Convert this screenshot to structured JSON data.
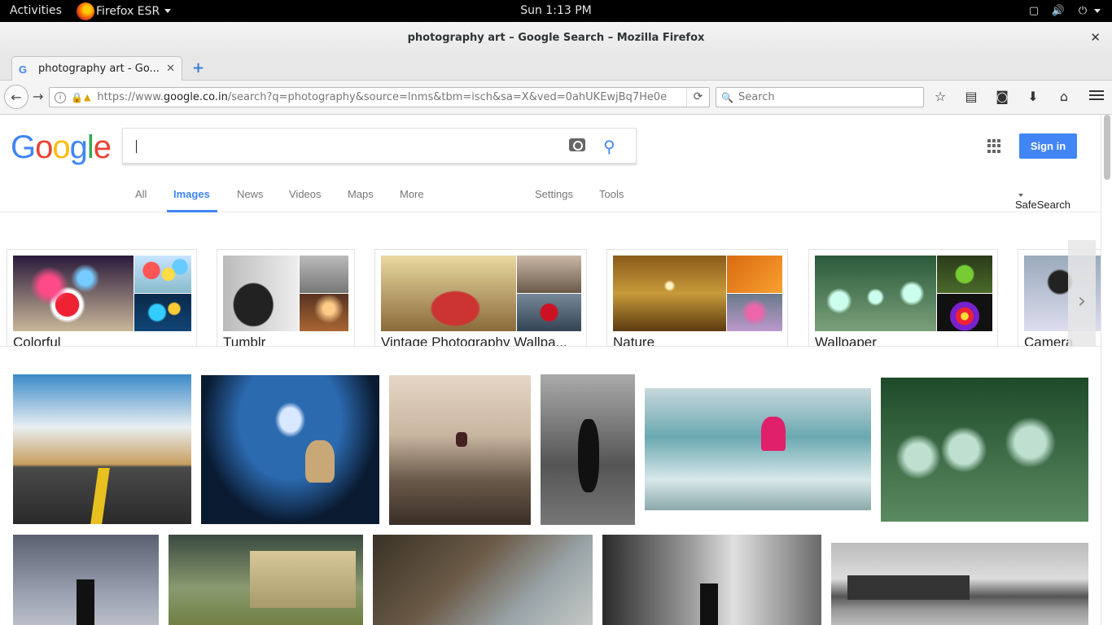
{
  "topbar": {
    "activities": "Activities",
    "app_name": "Firefox ESR",
    "clock": "Sun  1:13 PM"
  },
  "window": {
    "title": "photography art – Google Search – Mozilla Firefox",
    "tab_label": "photography art - Go...",
    "url_domain_pre": "https://www.",
    "url_domain": "google.co.in",
    "url_path": "/search?q=photography&source=lnms&tbm=isch&sa=X&ved=0ahUKEwjBq7He0e",
    "search_placeholder": "Search"
  },
  "google": {
    "logo": [
      "G",
      "o",
      "o",
      "g",
      "l",
      "e"
    ],
    "logo_colors": [
      "#4285f4",
      "#ea4335",
      "#fbbc05",
      "#4285f4",
      "#34a853",
      "#ea4335"
    ],
    "sign_in": "Sign in",
    "tabs": [
      "All",
      "Images",
      "News",
      "Videos",
      "Maps",
      "More"
    ],
    "settings": "Settings",
    "tools": "Tools",
    "safesearch": "SafeSearch"
  },
  "categories": [
    {
      "label": "Colorful"
    },
    {
      "label": "Tumblr"
    },
    {
      "label": "Vintage Photography Wallpa..."
    },
    {
      "label": "Nature"
    },
    {
      "label": "Wallpaper"
    },
    {
      "label": "Camera"
    }
  ],
  "colors": {
    "accent": "#4285f4",
    "signin_bg": "#4285f4"
  },
  "icons": {
    "back": "arrow-left-icon",
    "forward": "arrow-right-icon",
    "reload": "reload-icon",
    "bookmark": "star-icon",
    "reading_list": "clipboard-icon",
    "pocket": "pocket-icon",
    "download": "download-icon",
    "home": "home-icon",
    "menu": "hamburger-icon",
    "camera": "camera-icon",
    "search": "search-icon",
    "apps": "apps-grid-icon"
  }
}
